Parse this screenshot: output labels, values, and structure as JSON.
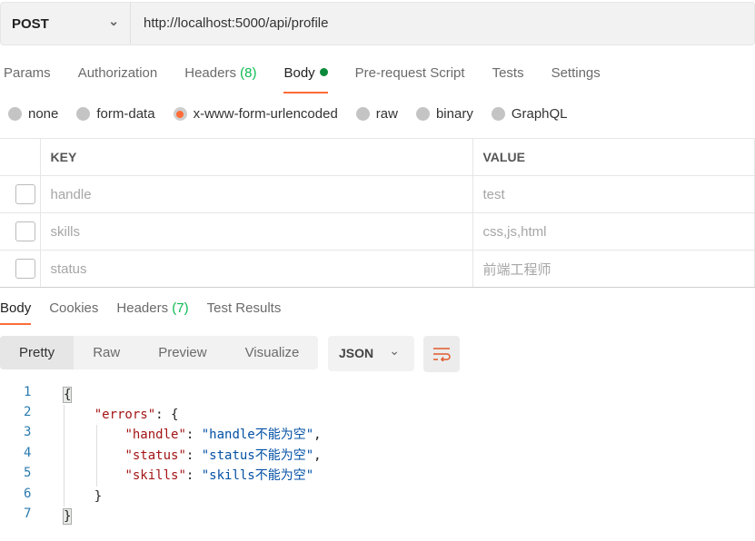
{
  "request": {
    "method": "POST",
    "url": "http://localhost:5000/api/profile"
  },
  "tabs": [
    {
      "label": "Params"
    },
    {
      "label": "Authorization"
    },
    {
      "label": "Headers",
      "count": "(8)"
    },
    {
      "label": "Body"
    },
    {
      "label": "Pre-request Script"
    },
    {
      "label": "Tests"
    },
    {
      "label": "Settings"
    }
  ],
  "body_types": [
    "none",
    "form-data",
    "x-www-form-urlencoded",
    "raw",
    "binary",
    "GraphQL"
  ],
  "selected_body_type": "x-www-form-urlencoded",
  "table": {
    "headers": [
      "KEY",
      "VALUE"
    ],
    "rows": [
      {
        "key": "handle",
        "value": "test"
      },
      {
        "key": "skills",
        "value": "css,js,html"
      },
      {
        "key": "status",
        "value": "前端工程师"
      }
    ]
  },
  "response_tabs": [
    {
      "label": "Body"
    },
    {
      "label": "Cookies"
    },
    {
      "label": "Headers",
      "count": "(7)"
    },
    {
      "label": "Test Results"
    }
  ],
  "view_modes": [
    "Pretty",
    "Raw",
    "Preview",
    "Visualize"
  ],
  "format": "JSON",
  "code": {
    "line_numbers": [
      "1",
      "2",
      "3",
      "4",
      "5",
      "6",
      "7"
    ],
    "open": "{",
    "errors_key": "\"errors\"",
    "colon": ": ",
    "inner_open": "{",
    "entries": [
      {
        "key": "\"handle\"",
        "value": "\"handle不能为空\"",
        "comma": ","
      },
      {
        "key": "\"status\"",
        "value": "\"status不能为空\"",
        "comma": ","
      },
      {
        "key": "\"skills\"",
        "value": "\"skills不能为空\"",
        "comma": ""
      }
    ],
    "inner_close": "}",
    "close": "}"
  },
  "colors": {
    "accent": "#ff6c37",
    "count": "#0cbb52"
  }
}
